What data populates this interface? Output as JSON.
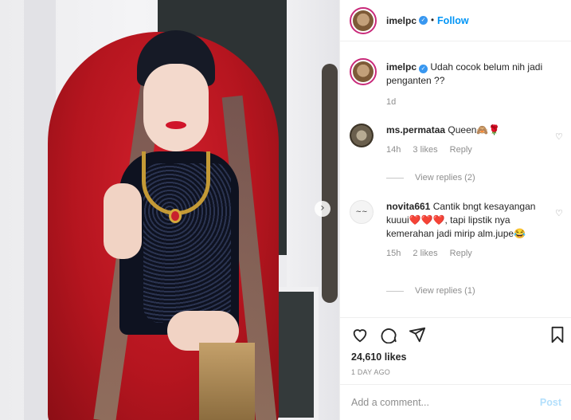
{
  "header": {
    "username": "imelpc",
    "separator": "•",
    "follow_label": "Follow"
  },
  "caption": {
    "username": "imelpc",
    "text": "Udah cocok belum nih jadi penganten ??",
    "time": "1d"
  },
  "comments": [
    {
      "username": "ms.permataa",
      "text": "Queen🙈🌹",
      "time": "14h",
      "likes": "3 likes",
      "reply_label": "Reply",
      "view_replies": "View replies (2)"
    },
    {
      "username": "novita661",
      "text": "Cantik bngt kesayangan kuuui❤️❤️❤️, tapi lipstik nya kemerahan jadi mirip alm.jupe😂",
      "time": "15h",
      "likes": "2 likes",
      "reply_label": "Reply",
      "view_replies": "View replies (1)"
    }
  ],
  "post_stats": {
    "likes": "24,610 likes",
    "ago": "1 DAY AGO"
  },
  "add_comment": {
    "placeholder": "Add a comment...",
    "post_label": "Post"
  },
  "icons": {
    "like": "heart-icon",
    "comment": "comment-icon",
    "share": "share-icon",
    "save": "bookmark-icon",
    "next": "chevron-right-icon",
    "verified": "verified-badge-icon"
  },
  "colors": {
    "accent": "#0095f6",
    "verified": "#3897f0",
    "post_disabled": "#b2dffc",
    "muted": "#8e8e8e"
  }
}
